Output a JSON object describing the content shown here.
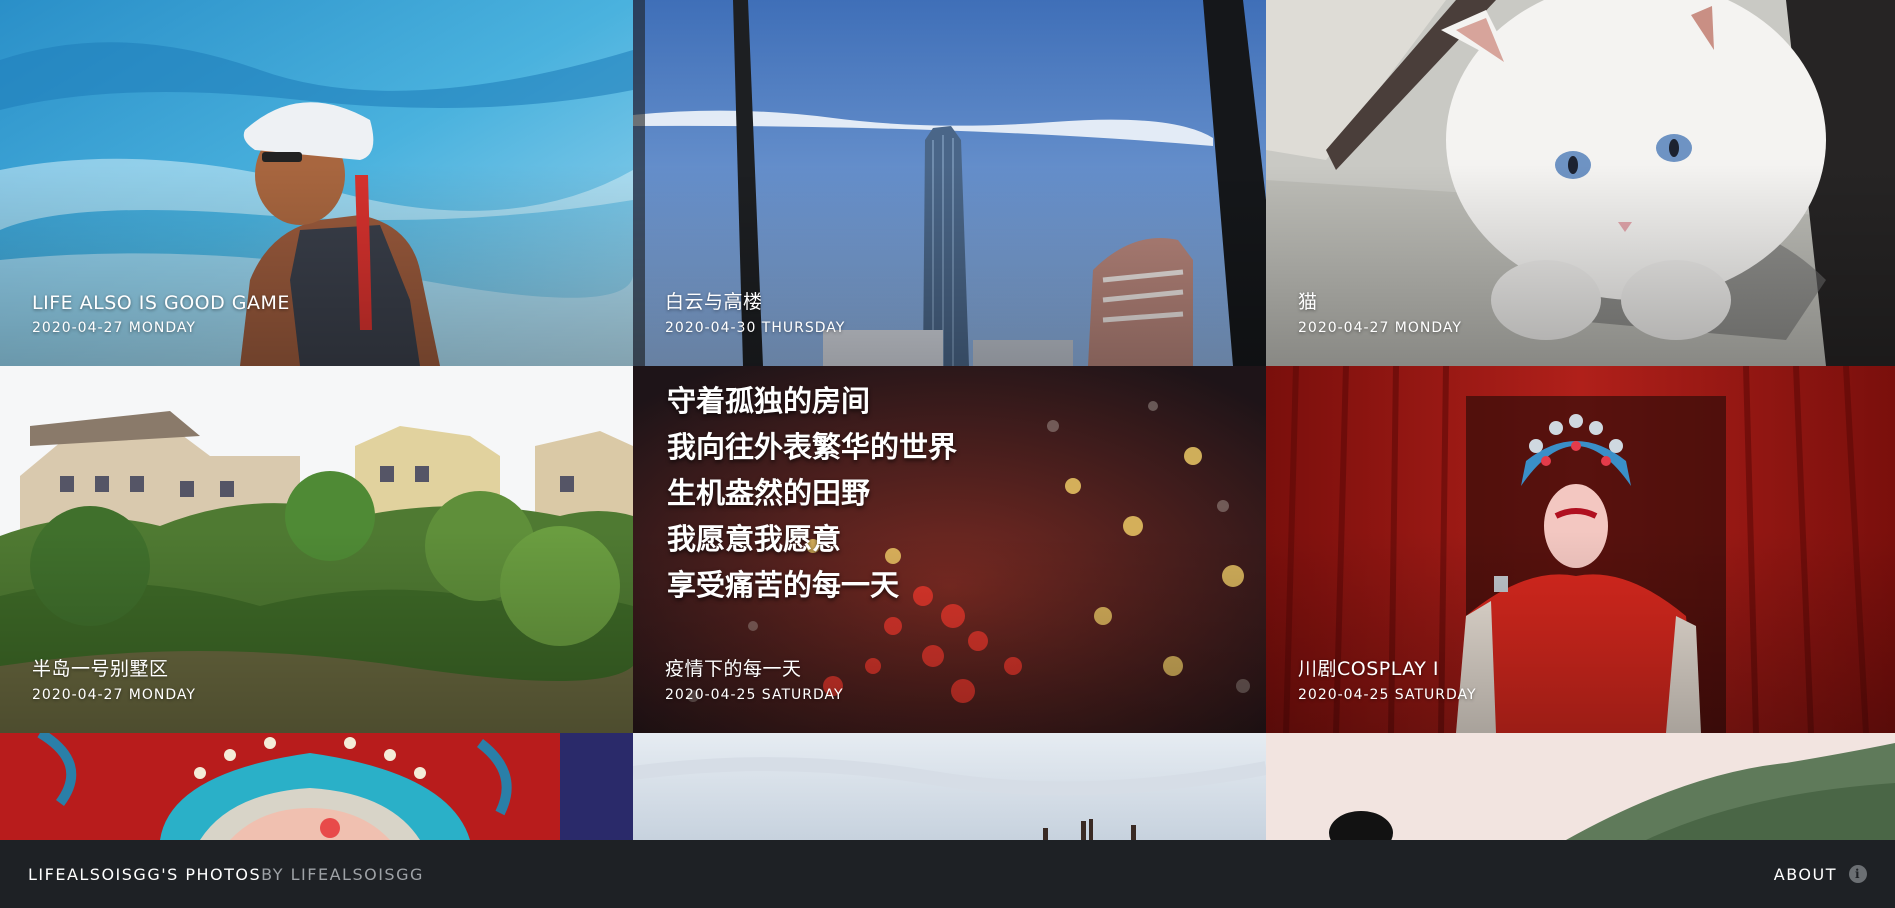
{
  "gallery": {
    "photos": [
      {
        "title": "LIFE ALSO IS GOOD GAME",
        "date": "2020-04-27 MONDAY"
      },
      {
        "title": "白云与高楼",
        "date": "2020-04-30 THURSDAY"
      },
      {
        "title": "猫",
        "date": "2020-04-27 MONDAY"
      },
      {
        "title": "半岛一号别墅区",
        "date": "2020-04-27 MONDAY"
      },
      {
        "title": "疫情下的每一天",
        "date": "2020-04-25 SATURDAY",
        "poem": [
          "守着孤独的房间",
          "我向往外表繁华的世界",
          "生机盎然的田野",
          "我愿意我愿意",
          "享受痛苦的每一天"
        ]
      },
      {
        "title": "川剧COSPLAY I",
        "date": "2020-04-25 SATURDAY"
      }
    ]
  },
  "footer": {
    "site_name": "LIFEALSOISGG'S PHOTOS",
    "by_line": "BY LIFEALSOISGG",
    "about_label": "ABOUT",
    "about_icon": "i"
  }
}
